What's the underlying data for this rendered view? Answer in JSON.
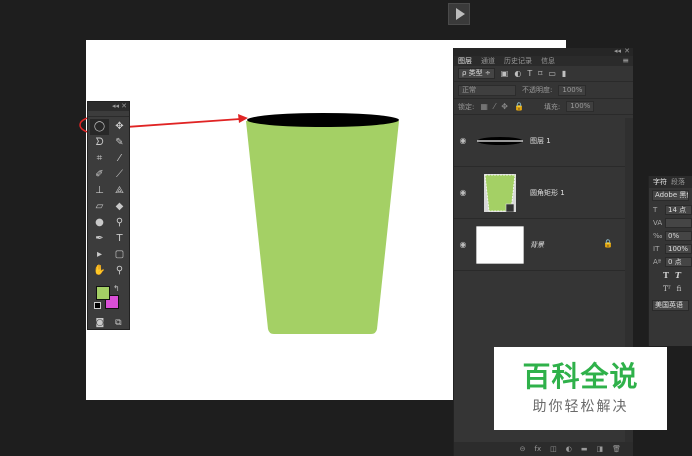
{
  "colors": {
    "foreground": "#a4d065",
    "background": "#d94fd7",
    "cup_fill": "#a4d065",
    "cup_rim": "#000000",
    "annotation": "#e02424",
    "watermark_green": "#2fb14a"
  },
  "tools_panel": {
    "collapse_glyph": "◂◂",
    "close_glyph": "✕",
    "tools": [
      {
        "name": "ellipse-marquee-tool-icon",
        "glyph": "◯"
      },
      {
        "name": "move-tool-icon",
        "glyph": "✥"
      },
      {
        "name": "lasso-tool-icon",
        "glyph": "ᗤ"
      },
      {
        "name": "quick-selection-tool-icon",
        "glyph": "✎"
      },
      {
        "name": "crop-tool-icon",
        "glyph": "⌗"
      },
      {
        "name": "eyedropper-tool-icon",
        "glyph": "⁄"
      },
      {
        "name": "healing-brush-tool-icon",
        "glyph": "✐"
      },
      {
        "name": "brush-tool-icon",
        "glyph": "⟋"
      },
      {
        "name": "clone-stamp-tool-icon",
        "glyph": "⊥"
      },
      {
        "name": "history-brush-tool-icon",
        "glyph": "⟁"
      },
      {
        "name": "eraser-tool-icon",
        "glyph": "▱"
      },
      {
        "name": "paint-bucket-tool-icon",
        "glyph": "◆"
      },
      {
        "name": "blur-tool-icon",
        "glyph": "●"
      },
      {
        "name": "dodge-tool-icon",
        "glyph": "⚲"
      },
      {
        "name": "pen-tool-icon",
        "glyph": "✒"
      },
      {
        "name": "type-tool-icon",
        "glyph": "T"
      },
      {
        "name": "path-selection-tool-icon",
        "glyph": "▸"
      },
      {
        "name": "rounded-rectangle-tool-icon",
        "glyph": "▢"
      },
      {
        "name": "hand-tool-icon",
        "glyph": "✋"
      },
      {
        "name": "zoom-tool-icon",
        "glyph": "⚲"
      }
    ],
    "swap_glyph": "↰",
    "quick_mask_glyph": "◙",
    "screen_mode_glyph": "⧉"
  },
  "layers_panel": {
    "collapse_glyph": "◂◂",
    "close_glyph": "✕",
    "tabs": [
      "图层",
      "通道",
      "历史记录",
      "信息"
    ],
    "menu_glyph": "≡",
    "filter_kind": "ρ 类型 ÷",
    "filter_icons": [
      "▣",
      "◐",
      "T",
      "⌑",
      "▭",
      "▮"
    ],
    "blend_mode": "正常",
    "opacity_label": "不透明度:",
    "opacity_value": "100%",
    "lock_label": "锁定:",
    "lock_icons": [
      "▦",
      "⁄",
      "✥",
      "🔒"
    ],
    "fill_label": "填充:",
    "fill_value": "100%",
    "layers": [
      {
        "name": "图层 1",
        "italic": false
      },
      {
        "name": "圆角矩形 1",
        "italic": false
      },
      {
        "name": "背景",
        "italic": true
      }
    ],
    "eye_glyph": "◉",
    "lock_glyph": "🔒",
    "footer_icons": [
      "⊝",
      "fx",
      "◫",
      "◐",
      "▬",
      "◨",
      "🗑"
    ]
  },
  "character_panel": {
    "tabs": [
      "字符",
      "段落"
    ],
    "font_family": "Adobe 黑体",
    "size_value": "14 点",
    "tracking_value": "0%",
    "scale_value": "100%",
    "baseline_value": "0 点",
    "size_icon": "T",
    "kerning_icon": "VA",
    "tracking_icon": "‰",
    "scale_icon": "IT",
    "baseline_icon": "Aª",
    "style_glyphs": [
      "T",
      "T"
    ],
    "extra_glyphs": [
      "Tᵀ",
      "fi"
    ],
    "language": "美国英语"
  },
  "watermark": {
    "title": "百科全说",
    "subtitle": "助你轻松解决"
  }
}
